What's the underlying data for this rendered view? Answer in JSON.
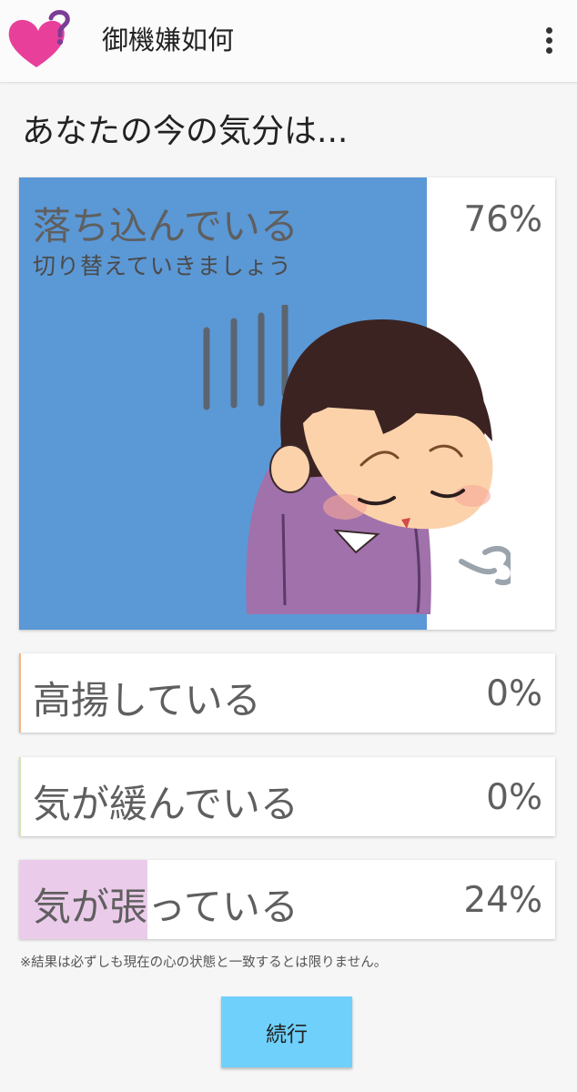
{
  "app": {
    "title": "御機嫌如何"
  },
  "question": "あなたの今の気分は...",
  "results": [
    {
      "label": "落ち込んでいる",
      "subtitle": "切り替えていきましょう",
      "percent_text": "76%",
      "fraction": 0.76,
      "color": "#5b98d6"
    },
    {
      "label": "高揚している",
      "percent_text": "0%",
      "fraction": 0.0,
      "color": "#f5b48a"
    },
    {
      "label": "気が緩んでいる",
      "percent_text": "0%",
      "fraction": 0.0,
      "color": "#cfe6b6"
    },
    {
      "label": "気が張っている",
      "percent_text": "24%",
      "fraction": 0.24,
      "color": "#ebcbea"
    }
  ],
  "disclaimer": "※結果は必ずしも現在の心の状態と一致するとは限りません。",
  "continue_button": "続行",
  "colors": {
    "logo_heart": "#e8409a",
    "logo_question": "#7c3d96",
    "button": "#6fd1fb"
  },
  "icons": [
    "heart-question-logo",
    "more-vert-icon",
    "depressed-woman-illustration"
  ]
}
